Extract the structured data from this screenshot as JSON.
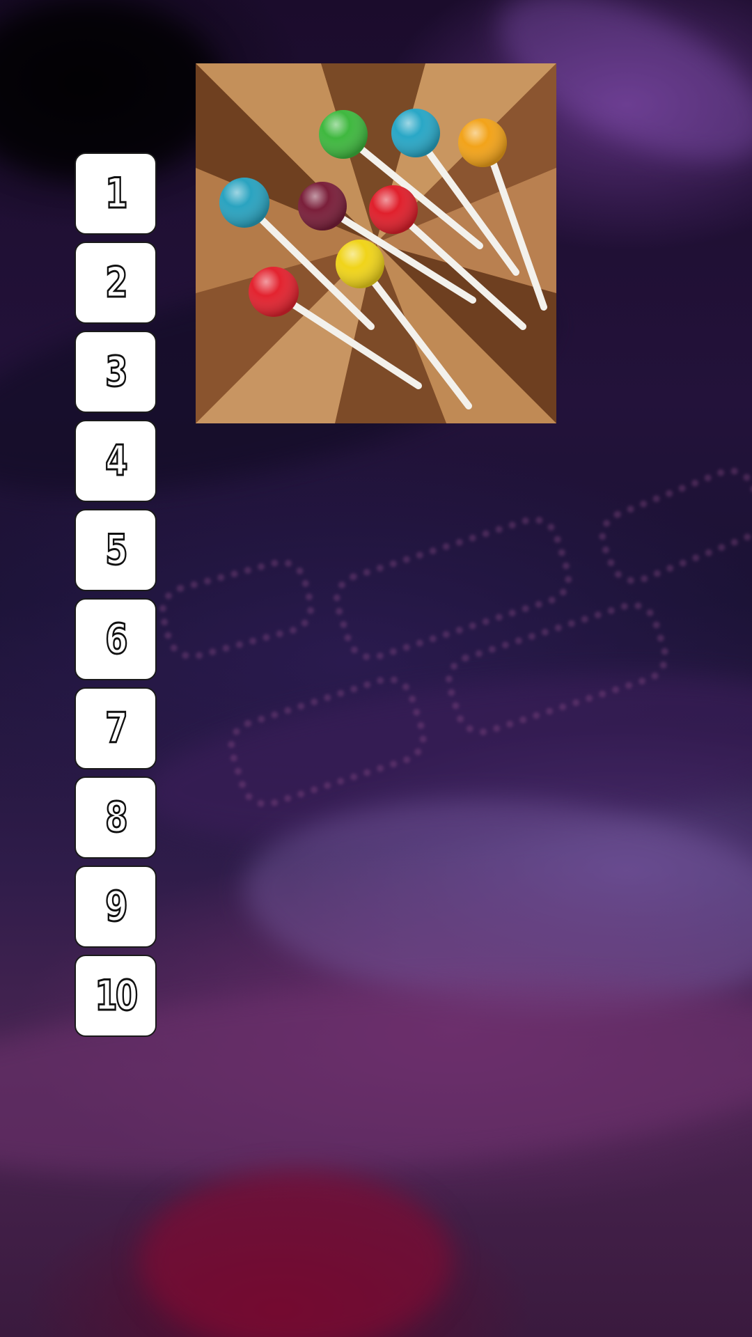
{
  "background": {
    "icon": "blurred-bedsheet-photo"
  },
  "number_buttons": [
    "1",
    "2",
    "3",
    "4",
    "5",
    "6",
    "7",
    "8",
    "9",
    "10"
  ],
  "photo": {
    "icon": "lollipops-on-wood-photo",
    "lollipop_colors": [
      "#3fb83f",
      "#29a7c6",
      "#f2a31a",
      "#2aa3c0",
      "#7a1f3a",
      "#e0202c",
      "#f0d41a",
      "#e3232f"
    ]
  }
}
